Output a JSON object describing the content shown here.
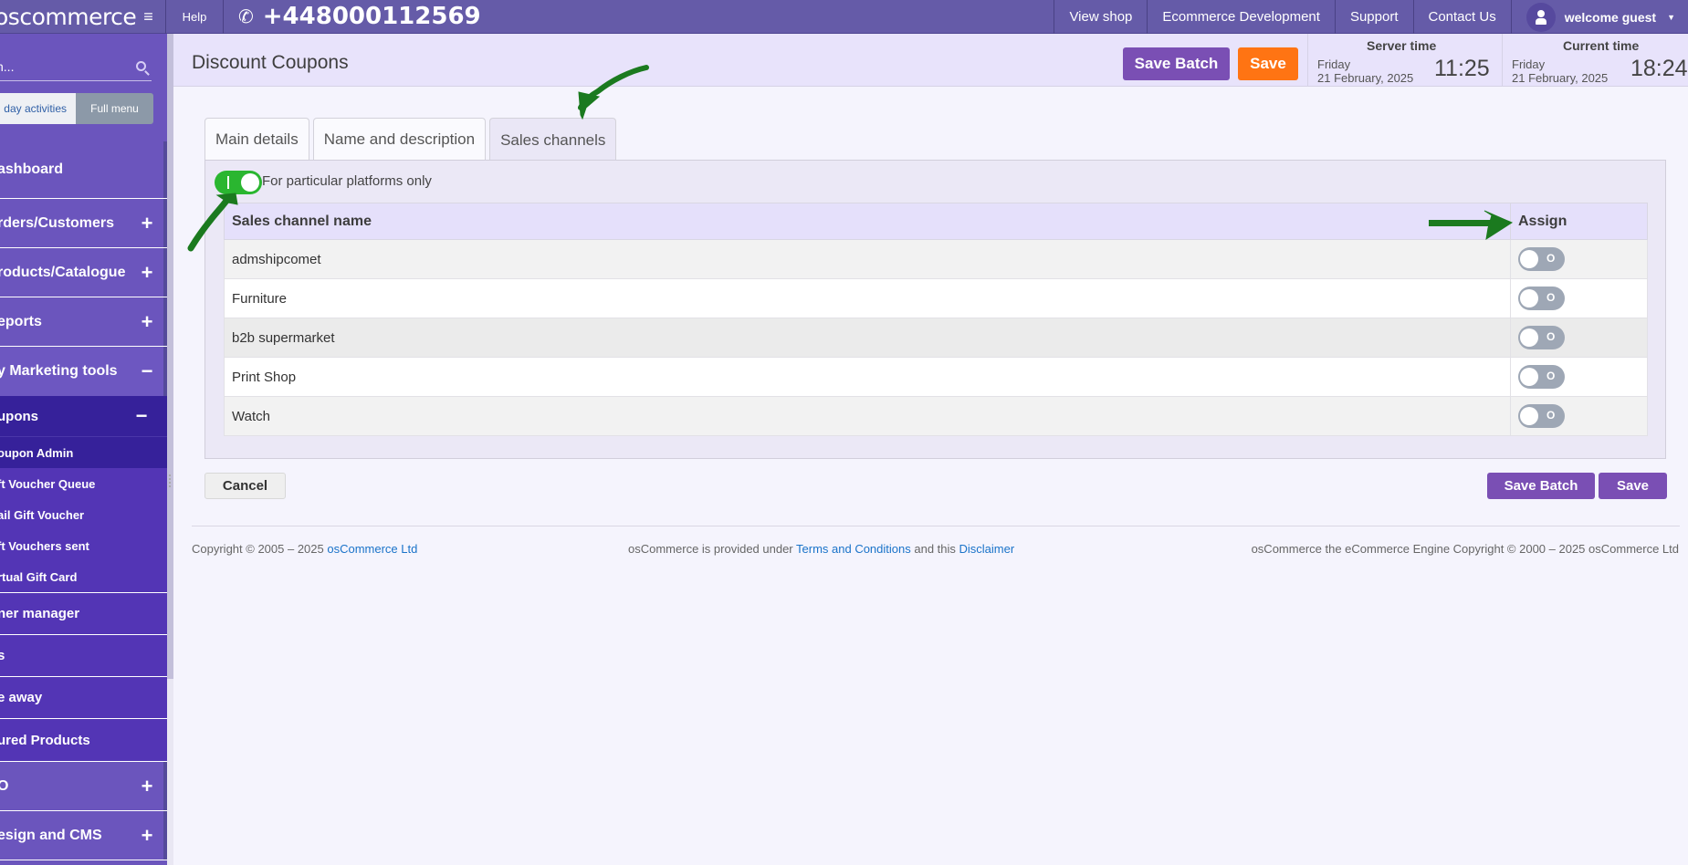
{
  "topbar": {
    "logo": "oscommerce",
    "menu_icon": "hamburger-icon",
    "help_label": "Help",
    "phone_icon": "phone-icon",
    "phone": "+448000112569",
    "links": [
      "View shop",
      "Ecommerce Development",
      "Support",
      "Contact Us"
    ],
    "user_icon": "user-icon",
    "user_label": "welcome guest"
  },
  "sidebar": {
    "search_placeholder": "h...",
    "search_icon": "search-icon",
    "mode_tabs": [
      "day activities",
      "Full menu"
    ],
    "items": [
      {
        "label": "ashboard",
        "toggle": ""
      },
      {
        "label": "rders/Customers",
        "toggle": "+"
      },
      {
        "label": "roducts/Catalogue",
        "toggle": "+"
      },
      {
        "label": "eports",
        "toggle": "+"
      },
      {
        "label": "y Marketing tools",
        "toggle": "−"
      },
      {
        "label": "upons",
        "toggle": "−"
      },
      {
        "label": "oupon Admin"
      },
      {
        "label": "ft Voucher Queue"
      },
      {
        "label": "ail Gift Voucher"
      },
      {
        "label": "ft Vouchers sent"
      },
      {
        "label": "rtual Gift Card"
      },
      {
        "label": "ner manager"
      },
      {
        "label": "s"
      },
      {
        "label": "e away"
      },
      {
        "label": "ured Products"
      },
      {
        "label": "O",
        "toggle": "+"
      },
      {
        "label": "esign and CMS",
        "toggle": "+"
      }
    ]
  },
  "header": {
    "title": "Discount Coupons",
    "save_batch_label": "Save Batch",
    "save_label": "Save",
    "server_time": {
      "title": "Server time",
      "day": "Friday",
      "date": "21 February, 2025",
      "clock": "11:25"
    },
    "current_time": {
      "title": "Current time",
      "day": "Friday",
      "date": "21 February, 2025",
      "clock": "18:24"
    }
  },
  "tabs": [
    {
      "label": "Main details",
      "active": false
    },
    {
      "label": "Name and description",
      "active": false
    },
    {
      "label": "Sales channels",
      "active": true
    }
  ],
  "sales_channels": {
    "platform_toggle_label": "For particular platforms only",
    "platform_toggle_on": true,
    "columns": [
      "Sales channel name",
      "Assign"
    ],
    "switch_off_text": "O",
    "rows": [
      {
        "name": "admshipcomet",
        "assigned": false
      },
      {
        "name": "Furniture",
        "assigned": false
      },
      {
        "name": "b2b supermarket",
        "assigned": false
      },
      {
        "name": "Print Shop",
        "assigned": false
      },
      {
        "name": "Watch",
        "assigned": false
      }
    ]
  },
  "actions": {
    "cancel_label": "Cancel",
    "save_batch_label": "Save Batch",
    "save_label": "Save"
  },
  "footer": {
    "copyright_prefix": "Copyright © 2005 – 2025 ",
    "copyright_link": "osCommerce Ltd",
    "license_prefix": "osCommerce is provided under ",
    "terms_link": "Terms and Conditions",
    "license_mid": " and this ",
    "disclaimer_link": "Disclaimer",
    "engine_text": "osCommerce the eCommerce Engine Copyright © 2000 – 2025 osCommerce Ltd"
  },
  "colors": {
    "topbar": "#655ba8",
    "sidebar": "#6b55bd",
    "sidebar_active": "#36219a",
    "primary_button": "#7a4fb4",
    "save_button": "#ff7413",
    "toggle_on": "#2ab630",
    "toggle_off": "#9ea7b5",
    "annotation_arrow": "#1b7a1f"
  }
}
